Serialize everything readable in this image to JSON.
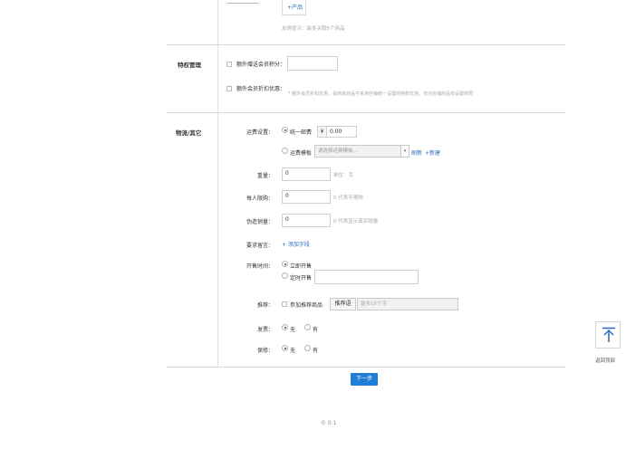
{
  "top": {
    "add_product_link": "+产品",
    "tip": "友情提示：最多关联5个商品"
  },
  "privilege": {
    "title": "特权管理",
    "extra_points_label": "额外赠送会员积分：",
    "extra_points_value": "",
    "discount_label": "额外会员折扣优惠：",
    "discount_hint": "* 额外会员折扣优惠，是商家商品不采用店铺统一设置的特权优惠，仅对店铺商品有设置权限"
  },
  "logistics": {
    "title": "物流/其它",
    "shipping_label": "运费设置：",
    "unified_shipping": "统一邮费",
    "currency": "¥",
    "shipping_value": "0.00",
    "template_label": "运费模板",
    "template_placeholder": "请选择运费模板...",
    "refresh_link": "刷新",
    "new_link": "+新建",
    "weight_label": "重量：",
    "weight_value": "0",
    "weight_unit": "单位：克",
    "limit_label": "每人限购：",
    "limit_value": "0",
    "limit_hint": "0 代表不限购",
    "fake_sales_label": "伪造销量：",
    "fake_sales_value": "0",
    "fake_sales_hint": "0 代表显示真实销量",
    "message_label": "要求留言：",
    "add_field_link": "+ 添加字段",
    "sale_time_label": "开售时间：",
    "sale_now": "立即开售",
    "sale_scheduled": "定时开售",
    "sale_time_value": "",
    "recommend_label": "推荐：",
    "recommend_checkbox": "参加推荐商品",
    "recommend_button": "推荐语",
    "recommend_placeholder": "最多15个字",
    "invoice_label": "发票：",
    "invoice_no": "无",
    "invoice_yes": "有",
    "warranty_label": "保修：",
    "warranty_no": "无",
    "warranty_yes": "有"
  },
  "actions": {
    "next_button": "下一步"
  },
  "footer": {
    "copyright": "© 0.1"
  },
  "back_to_top": {
    "label": "返回顶部"
  },
  "colors": {
    "primary": "#1f7ed6",
    "link": "#2a6fb6"
  }
}
